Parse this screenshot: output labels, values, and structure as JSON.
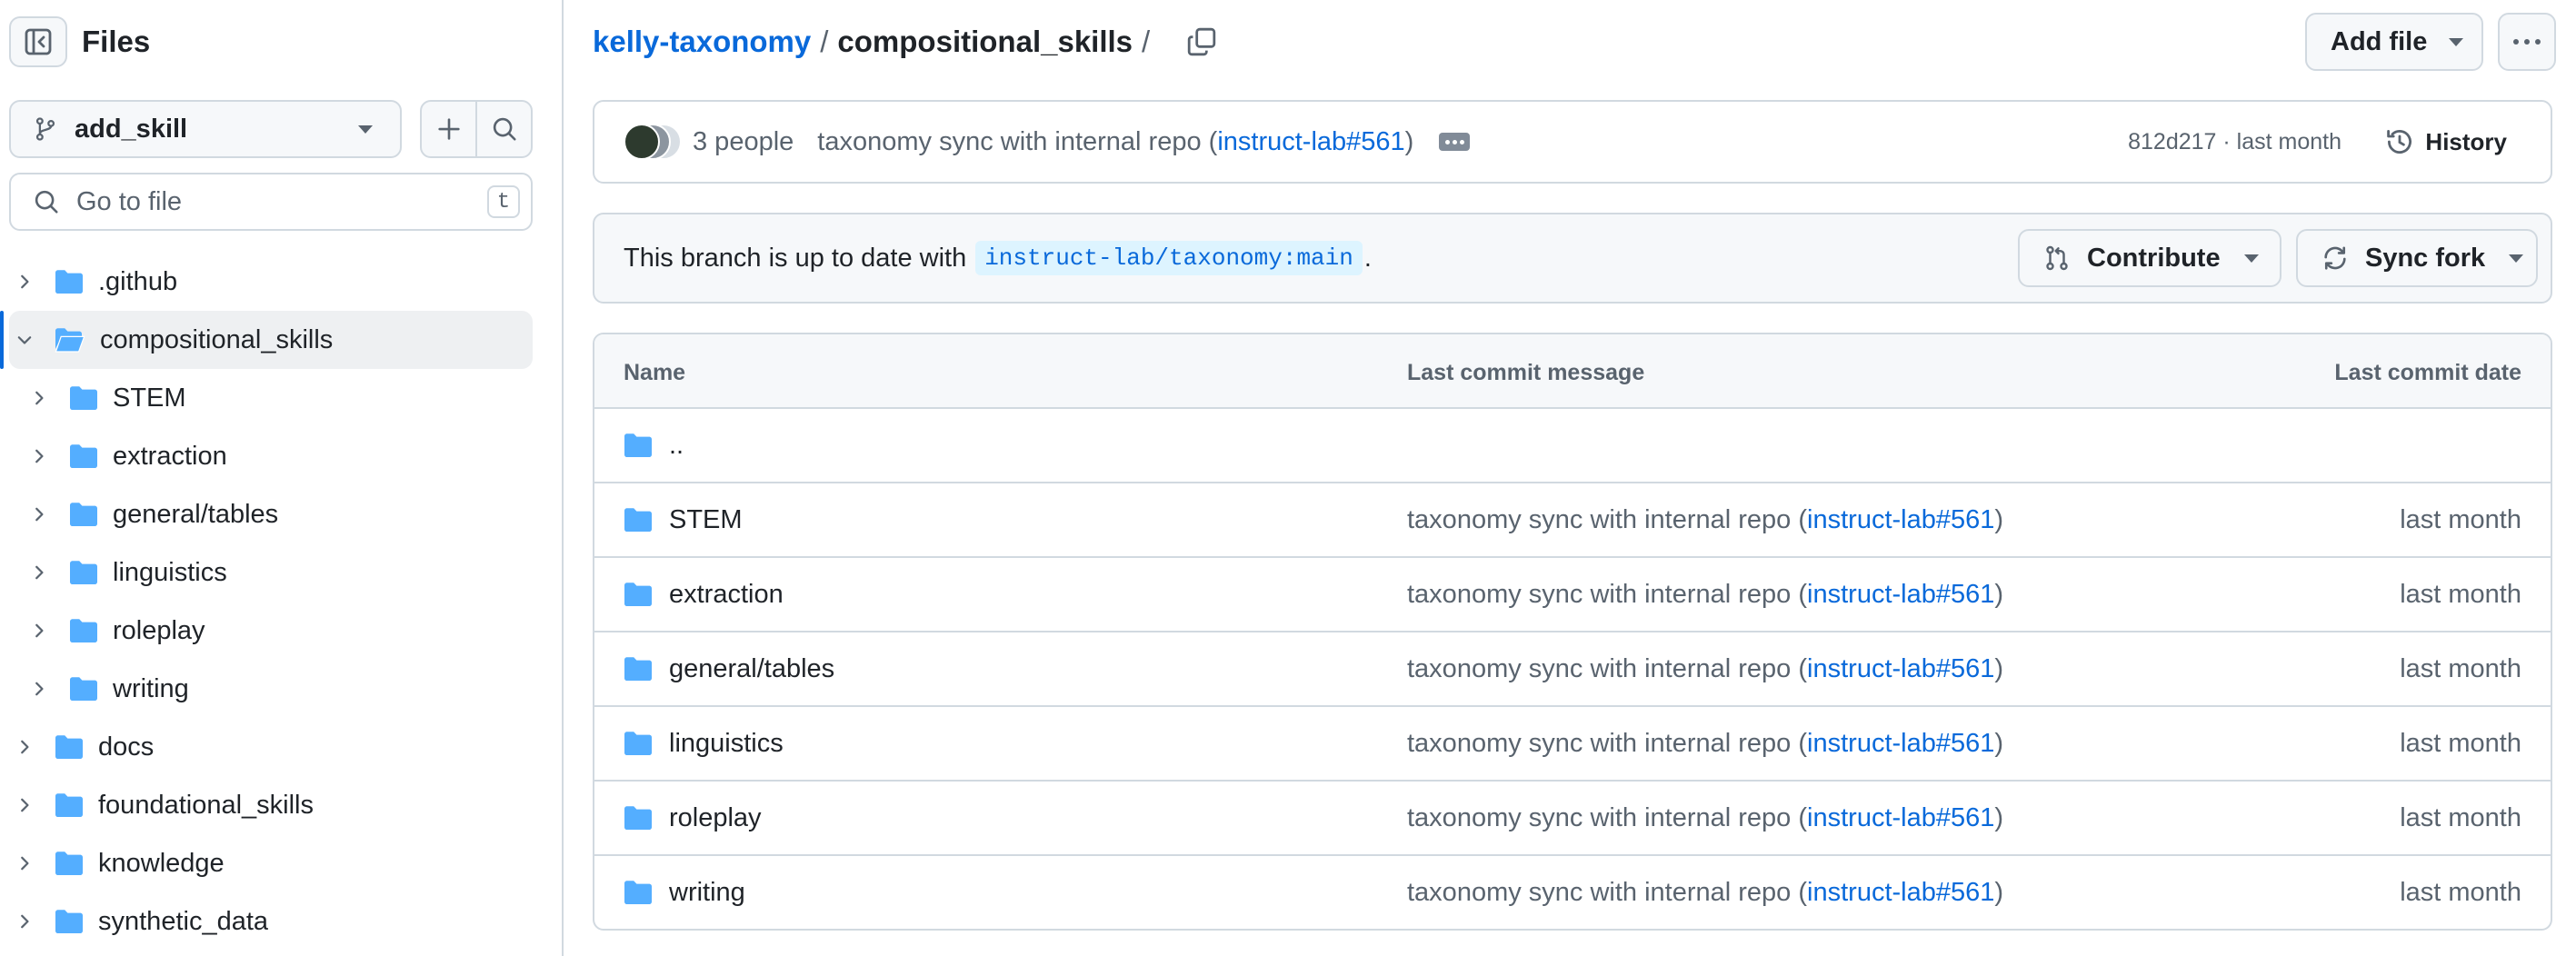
{
  "sidebar": {
    "title": "Files",
    "branch": "add_skill",
    "goto_placeholder": "Go to file",
    "goto_shortcut": "t",
    "tree": [
      {
        "name": ".github",
        "level": 0,
        "expanded": false
      },
      {
        "name": "compositional_skills",
        "level": 0,
        "expanded": true,
        "selected": true
      },
      {
        "name": "STEM",
        "level": 1,
        "expanded": false
      },
      {
        "name": "extraction",
        "level": 1,
        "expanded": false
      },
      {
        "name": "general/tables",
        "level": 1,
        "expanded": false
      },
      {
        "name": "linguistics",
        "level": 1,
        "expanded": false
      },
      {
        "name": "roleplay",
        "level": 1,
        "expanded": false
      },
      {
        "name": "writing",
        "level": 1,
        "expanded": false
      },
      {
        "name": "docs",
        "level": 0,
        "expanded": false
      },
      {
        "name": "foundational_skills",
        "level": 0,
        "expanded": false
      },
      {
        "name": "knowledge",
        "level": 0,
        "expanded": false
      },
      {
        "name": "synthetic_data",
        "level": 0,
        "expanded": false
      }
    ]
  },
  "header": {
    "repo": "kelly-taxonomy",
    "sep1": "/",
    "path": "compositional_skills",
    "sep2": "/",
    "add_file": "Add file"
  },
  "commit": {
    "people": "3 people",
    "message_prefix": "taxonomy sync with internal repo (",
    "message_link": "instruct-lab#561",
    "message_suffix": ")",
    "meta": "812d217 · last month",
    "history": "History"
  },
  "branch_status": {
    "text": "This branch is up to date with",
    "ref": "instruct-lab/taxonomy:main",
    "period": ".",
    "contribute": "Contribute",
    "sync_fork": "Sync fork"
  },
  "table": {
    "headers": {
      "name": "Name",
      "message": "Last commit message",
      "date": "Last commit date"
    },
    "parent": "..",
    "rows": [
      {
        "name": "STEM",
        "msg_prefix": "taxonomy sync with internal repo (",
        "msg_link": "instruct-lab#561",
        "msg_suffix": ")",
        "date": "last month"
      },
      {
        "name": "extraction",
        "msg_prefix": "taxonomy sync with internal repo (",
        "msg_link": "instruct-lab#561",
        "msg_suffix": ")",
        "date": "last month"
      },
      {
        "name": "general/tables",
        "msg_prefix": "taxonomy sync with internal repo (",
        "msg_link": "instruct-lab#561",
        "msg_suffix": ")",
        "date": "last month"
      },
      {
        "name": "linguistics",
        "msg_prefix": "taxonomy sync with internal repo (",
        "msg_link": "instruct-lab#561",
        "msg_suffix": ")",
        "date": "last month"
      },
      {
        "name": "roleplay",
        "msg_prefix": "taxonomy sync with internal repo (",
        "msg_link": "instruct-lab#561",
        "msg_suffix": ")",
        "date": "last month"
      },
      {
        "name": "writing",
        "msg_prefix": "taxonomy sync with internal repo (",
        "msg_link": "instruct-lab#561",
        "msg_suffix": ")",
        "date": "last month"
      }
    ]
  },
  "colors": {
    "link": "#0969da",
    "folder": "#54aeff",
    "border": "#d1d9e0",
    "muted": "#59636e"
  },
  "icons": [
    "sidebar-collapse-icon",
    "git-branch-icon",
    "plus-icon",
    "search-icon",
    "chevron-right-icon",
    "chevron-down-icon",
    "folder-icon",
    "folder-open-icon",
    "copy-icon",
    "kebab-horizontal-icon",
    "history-icon",
    "git-pull-request-icon",
    "sync-icon"
  ]
}
